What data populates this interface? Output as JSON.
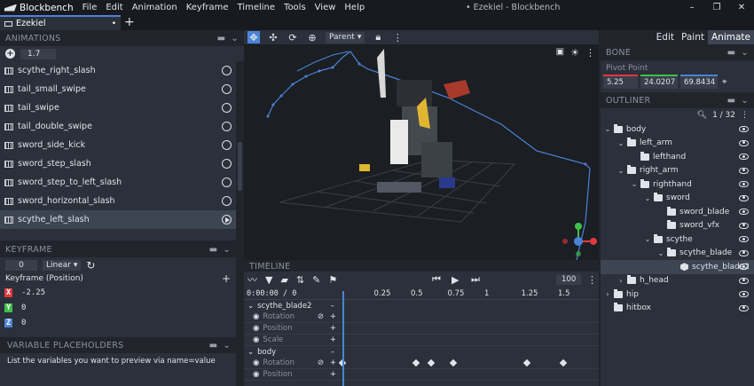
{
  "app": {
    "name": "Blockbench",
    "window_title": "• Ezekiel - Blockbench",
    "colors": {
      "accent": "#4a84d6",
      "bg": "#21252b",
      "panel": "#2b303a"
    }
  },
  "menu": [
    "File",
    "Edit",
    "Animation",
    "Keyframe",
    "Timeline",
    "Tools",
    "View",
    "Help"
  ],
  "tab": {
    "label": "Ezekiel",
    "close": "•",
    "new": "+"
  },
  "modes": [
    "Edit",
    "Paint",
    "Animate"
  ],
  "animations": {
    "title": "ANIMATIONS",
    "speed": "1.7",
    "items": [
      "scythe_right_slash",
      "tail_small_swipe",
      "tail_swipe",
      "tail_double_swipe",
      "sword_side_kick",
      "sword_step_slash",
      "sword_step_to_left_slash",
      "sword_horizontal_slash",
      "scythe_left_slash"
    ],
    "selected": "scythe_left_slash"
  },
  "keyframe": {
    "title": "KEYFRAME",
    "time": "0",
    "interpolation": "Linear",
    "channel_label": "Keyframe (Position)",
    "x": "-2.25",
    "y": "0",
    "z": "0",
    "x_label": "X",
    "y_label": "Y",
    "z_label": "Z"
  },
  "placeholders": {
    "title": "VARIABLE PLACEHOLDERS",
    "text": "List the variables you want to preview via name=value"
  },
  "viewport": {
    "parent_label": "Parent"
  },
  "bone": {
    "title": "BONE",
    "pivot_label": "Pivot Point",
    "x": "5.25",
    "y": "24.0207",
    "z": "69.8434"
  },
  "outliner": {
    "title": "OUTLINER",
    "count": "1 / 32",
    "rows": [
      {
        "label": "body",
        "depth": 0,
        "type": "folder",
        "fold": "open"
      },
      {
        "label": "left_arm",
        "depth": 1,
        "type": "folder",
        "fold": "open"
      },
      {
        "label": "lefthand",
        "depth": 2,
        "type": "folder",
        "fold": ""
      },
      {
        "label": "right_arm",
        "depth": 1,
        "type": "folder",
        "fold": "open"
      },
      {
        "label": "righthand",
        "depth": 2,
        "type": "folder",
        "fold": "open"
      },
      {
        "label": "sword",
        "depth": 3,
        "type": "folder",
        "fold": "open"
      },
      {
        "label": "sword_blade",
        "depth": 4,
        "type": "folder",
        "fold": ""
      },
      {
        "label": "sword_vfx",
        "depth": 4,
        "type": "folder",
        "fold": ""
      },
      {
        "label": "scythe",
        "depth": 3,
        "type": "folder",
        "fold": "open"
      },
      {
        "label": "scythe_blade",
        "depth": 4,
        "type": "folder",
        "fold": "open"
      },
      {
        "label": "scythe_blade2",
        "depth": 5,
        "type": "cube",
        "fold": ""
      },
      {
        "label": "h_head",
        "depth": 1,
        "type": "folder",
        "fold": "closed"
      },
      {
        "label": "hip",
        "depth": 0,
        "type": "folder",
        "fold": "closed"
      },
      {
        "label": "hitbox",
        "depth": 0,
        "type": "folder",
        "fold": ""
      }
    ],
    "selected": "scythe_blade2"
  },
  "timeline": {
    "title": "TIMELINE",
    "timecode": "0:00:00",
    "frame": "0",
    "zoom": "100",
    "ticks": [
      "0",
      "0.25",
      "0.5",
      "0.75",
      "1",
      "1.25",
      "1.5"
    ],
    "groups": [
      {
        "name": "scythe_blade2",
        "channels": [
          "Rotation",
          "Position",
          "Scale"
        ]
      },
      {
        "name": "body",
        "channels": [
          "Rotation",
          "Position"
        ]
      }
    ],
    "body_rotation_keyframes": [
      0,
      0.5,
      0.6,
      0.75,
      1.25,
      1.5
    ]
  }
}
